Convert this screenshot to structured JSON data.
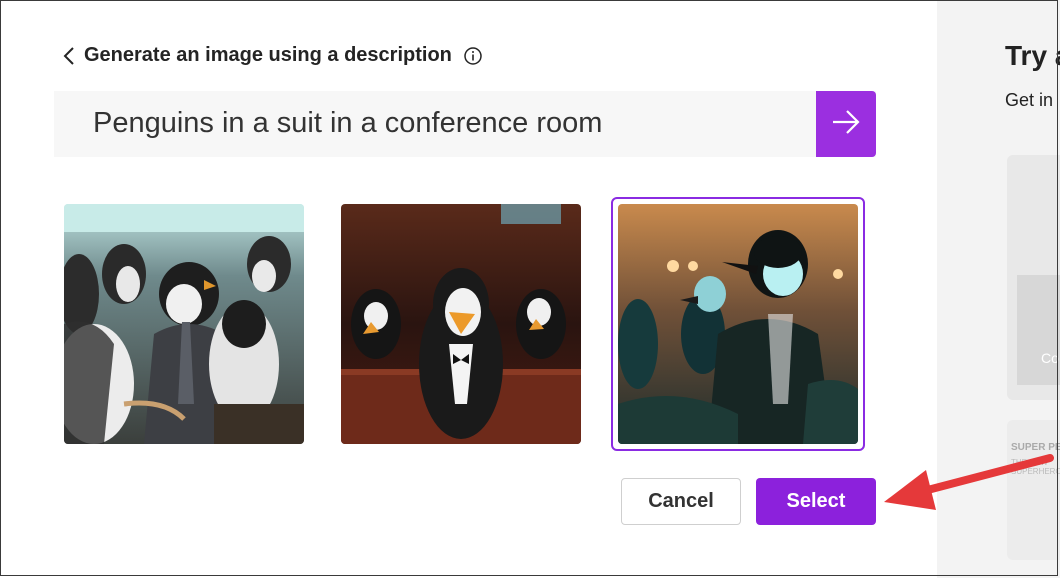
{
  "dialog": {
    "title": "Generate an image using a description",
    "prompt_text": "Penguins in a suit in a conference room",
    "cancel_label": "Cancel",
    "select_label": "Select",
    "selected_image": 3,
    "images": [
      {
        "label": "Penguins in suits, conference seats"
      },
      {
        "label": "Penguin in tuxedo at table"
      },
      {
        "label": "Penguin in suit with blue face"
      }
    ]
  },
  "right_panel": {
    "title": "Try a",
    "subtitle": "Get in",
    "card1_text": "Co",
    "card2_heading": "SUPER PE",
    "card2_line": "THE NEW SUPERHERO"
  },
  "colors": {
    "accent": "#8c21dc",
    "annotation_arrow": "#e5393a"
  },
  "icons": [
    "chevron-left-icon",
    "info-icon",
    "arrow-right-icon"
  ]
}
